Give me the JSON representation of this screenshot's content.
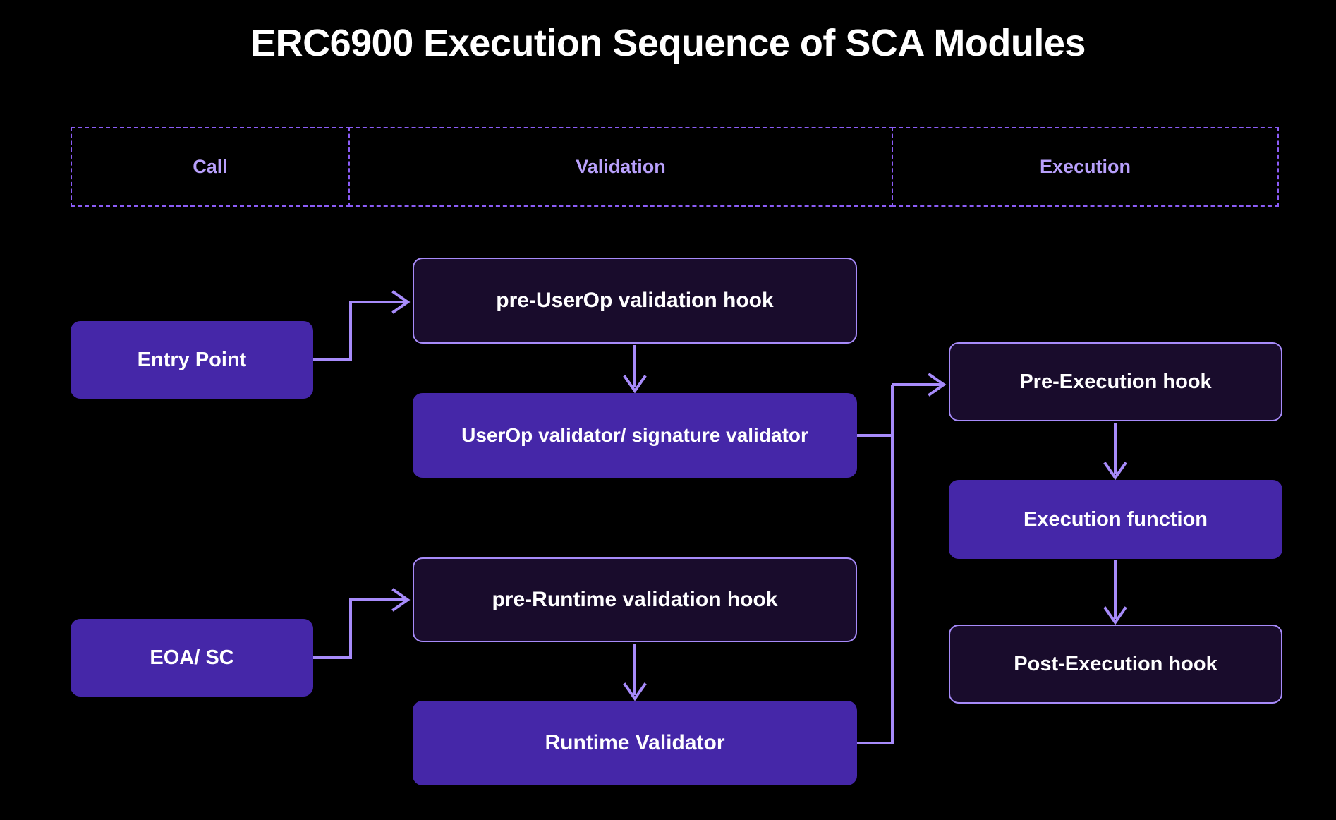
{
  "title": "ERC6900 Execution Sequence of SCA Modules",
  "colors": {
    "background": "#000000",
    "accent_purple": "#4527a8",
    "border_purple": "#a78bfa",
    "phase_text": "#b8a0fb",
    "dark_fill": "#190c2c",
    "title_text": "#ffffff"
  },
  "phases": [
    {
      "label": "Call"
    },
    {
      "label": "Validation"
    },
    {
      "label": "Execution"
    }
  ],
  "nodes": {
    "entry_point": "Entry Point",
    "eoa_sc": "EOA/ SC",
    "pre_userop_hook": "pre-UserOp validation hook",
    "userop_validator": "UserOp validator/ signature validator",
    "pre_runtime_hook": "pre-Runtime validation hook",
    "runtime_validator": "Runtime Validator",
    "pre_exec_hook": "Pre-Execution hook",
    "exec_function": "Execution function",
    "post_exec_hook": "Post-Execution hook"
  },
  "edges": [
    {
      "from": "entry_point",
      "to": "pre_userop_hook",
      "arrow": true
    },
    {
      "from": "pre_userop_hook",
      "to": "userop_validator",
      "arrow": true
    },
    {
      "from": "eoa_sc",
      "to": "pre_runtime_hook",
      "arrow": true
    },
    {
      "from": "pre_runtime_hook",
      "to": "runtime_validator",
      "arrow": true
    },
    {
      "from": "userop_validator",
      "to": "pre_exec_hook",
      "arrow": true
    },
    {
      "from": "runtime_validator",
      "to": "pre_exec_hook",
      "arrow": true
    },
    {
      "from": "pre_exec_hook",
      "to": "exec_function",
      "arrow": true
    },
    {
      "from": "exec_function",
      "to": "post_exec_hook",
      "arrow": true
    }
  ]
}
